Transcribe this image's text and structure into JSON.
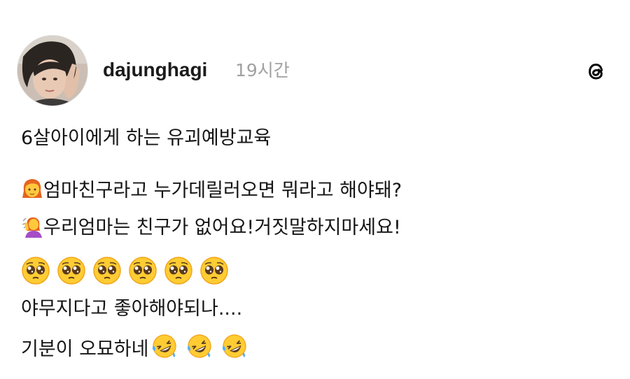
{
  "post": {
    "author": "dajunghagi",
    "time": "19시간",
    "lines": [
      "6살아이에게 하는 유괴예방교육",
      "엄마친구라고 누가데릴러오면 뭐라고 해야돼?",
      "우리엄마는 친구가 없어요!거짓말하지마세요!",
      "야무지다고 좋아해야되나....",
      "기분이 오묘하네"
    ]
  },
  "icons": {
    "logo": "threads-logo-icon",
    "line2_emoji": "woman-emoji",
    "line3_emoji": "woman-tipping-hand-emoji",
    "pleading_emoji": "pleading-face-emoji",
    "rofl_emoji": "rolling-on-floor-laughing-emoji"
  }
}
